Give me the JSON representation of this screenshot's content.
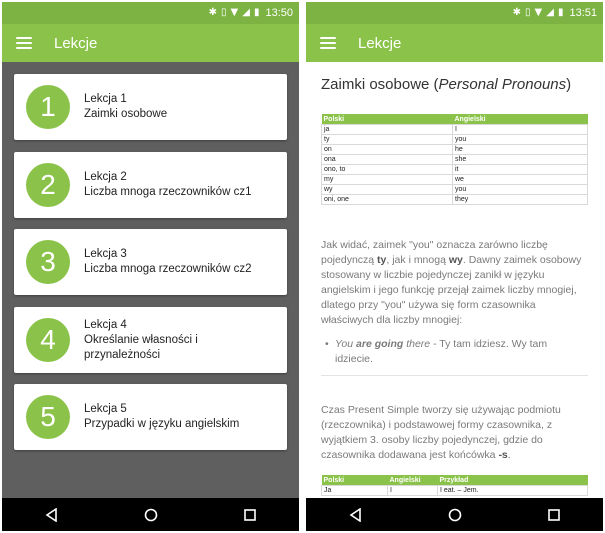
{
  "left_screen": {
    "status": {
      "time": "13:50"
    },
    "appbar": {
      "title": "Lekcje"
    },
    "lessons": [
      {
        "number": "1",
        "line1": "Lekcja 1",
        "line2": "Zaimki osobowe",
        "line3": ""
      },
      {
        "number": "2",
        "line1": "Lekcja 2",
        "line2": "Liczba mnoga rzeczowników cz1",
        "line3": ""
      },
      {
        "number": "3",
        "line1": "Lekcja 3",
        "line2": "Liczba mnoga rzeczowników cz2",
        "line3": ""
      },
      {
        "number": "4",
        "line1": "Lekcja 4",
        "line2": "Określanie własności i",
        "line3": "przynależności"
      },
      {
        "number": "5",
        "line1": "Lekcja 5",
        "line2": "Przypadki w języku angielskim",
        "line3": ""
      }
    ]
  },
  "right_screen": {
    "status": {
      "time": "13:51"
    },
    "appbar": {
      "title": "Lekcje"
    },
    "doc_title": {
      "main": "Zaimki osobowe (",
      "italic": "Personal Pronouns",
      "end": ")"
    },
    "pronoun_table": {
      "headers": [
        "Polski",
        "Angielski"
      ],
      "rows": [
        [
          "ja",
          "I"
        ],
        [
          "ty",
          "you"
        ],
        [
          "on",
          "he"
        ],
        [
          "ona",
          "she"
        ],
        [
          "ono, to",
          "it"
        ],
        [
          "my",
          "we"
        ],
        [
          "wy",
          "you"
        ],
        [
          "oni, one",
          "they"
        ]
      ]
    },
    "para1": {
      "a": "Jak widać, zaimek \"you\" oznacza zarówno liczbę pojedynczą ",
      "b1": "ty",
      "c": ", jak i mnogą ",
      "b2": "wy",
      "d": ". Dawny zaimek osobowy stosowany w liczbie pojedynczej zanikł w języku angielskim i jego funkcję przejął zaimek liczby mnogiej, dlatego przy \"you\" używa się form czasownika właściwych dla liczby mnogiej:"
    },
    "bullet": {
      "italic_a": "You ",
      "bold_italic": "are going",
      "italic_b": " there",
      "rest": " - Ty tam idziesz. Wy tam idziecie."
    },
    "para2": {
      "a": "Czas Present Simple tworzy się używając podmiotu (rzeczownika) i podstawowej formy czasownika, z wyjątkiem 3. osoby liczby pojedynczej, gdzie do czasownika dodawana jest końcówka ",
      "b": "-s",
      "c": "."
    },
    "verb_table": {
      "headers": [
        "Polski",
        "Angielski",
        "Przykład"
      ],
      "row": [
        "Ja",
        "I",
        "I eat. – Jem."
      ]
    }
  }
}
